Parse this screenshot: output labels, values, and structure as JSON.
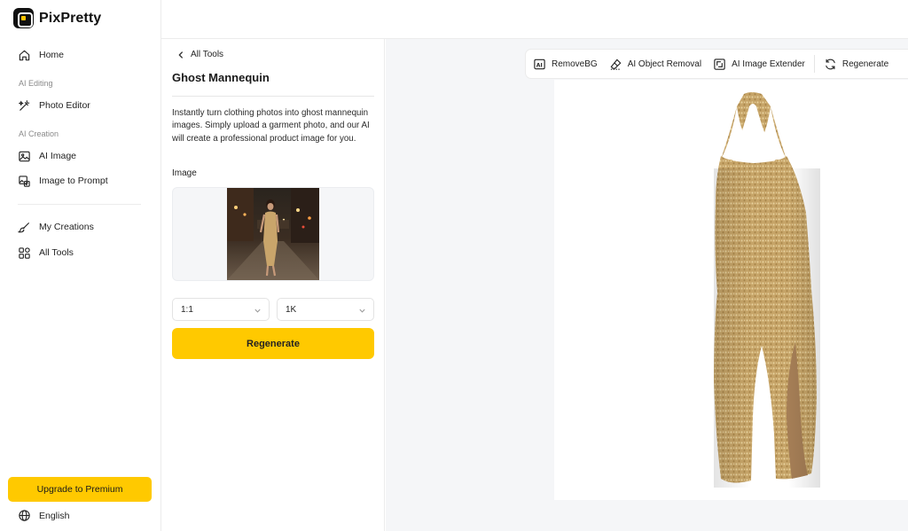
{
  "brand": {
    "name": "PixPretty"
  },
  "sidebar": {
    "items": [
      {
        "label": "Home",
        "icon": "home-icon"
      },
      {
        "label": "Photo Editor",
        "icon": "magic-edit-icon"
      },
      {
        "label": "AI Image",
        "icon": "image-icon"
      },
      {
        "label": "Image to Prompt",
        "icon": "image-prompt-icon"
      },
      {
        "label": "My Creations",
        "icon": "brush-icon"
      },
      {
        "label": "All Tools",
        "icon": "grid-icon"
      }
    ],
    "sections": {
      "editing": "AI Editing",
      "creation": "AI Creation"
    },
    "premium_label": "Upgrade to Premium",
    "language": "English"
  },
  "panel": {
    "back_label": "All Tools",
    "title": "Ghost Mannequin",
    "description": "Instantly turn clothing photos into ghost mannequin images. Simply upload a garment photo, and our AI will create a professional product image for you.",
    "image_label": "Image",
    "aspect_ratio": "1:1",
    "resolution": "1K",
    "regenerate_label": "Regenerate"
  },
  "toolbar": {
    "items": [
      {
        "label": "RemoveBG",
        "icon": "remove-bg-icon"
      },
      {
        "label": "AI Object Removal",
        "icon": "eraser-icon"
      },
      {
        "label": "AI Image Extender",
        "icon": "expand-icon"
      },
      {
        "label": "Regenerate",
        "icon": "refresh-icon"
      }
    ]
  },
  "colors": {
    "accent": "#ffc900",
    "canvas_bg": "#f5f6f8",
    "dress": "#c9a56b"
  }
}
